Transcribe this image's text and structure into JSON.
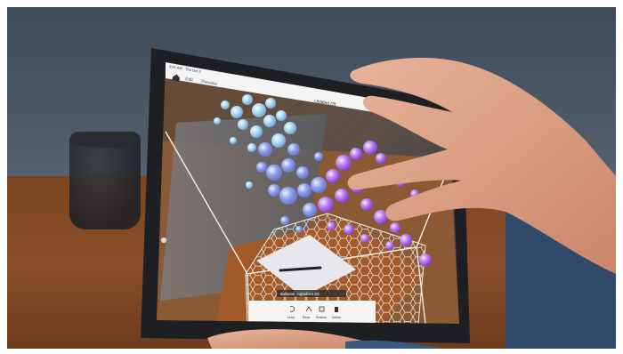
{
  "status_bar": {
    "time": "9:41 AM",
    "date": "Thu Oct 3"
  },
  "app": {
    "tabs": [
      "Edit",
      "Preview"
    ],
    "document_title": "Untitled (3)"
  },
  "toolbar": {
    "items": [
      "Undo",
      "Redo",
      "Restore",
      "Delete"
    ]
  },
  "object_label": "Balloons: Ingredient 2D",
  "colors": {
    "particles_light": "#a9d8ef",
    "particles_mid": "#8a9de8",
    "particles_dark": "#a05ee0",
    "tablet_frame": "#1d1f22",
    "ui_bar": "#f4f4f5"
  },
  "icons": [
    "home-icon",
    "undo-icon",
    "redo-icon",
    "restore-icon",
    "delete-icon"
  ]
}
